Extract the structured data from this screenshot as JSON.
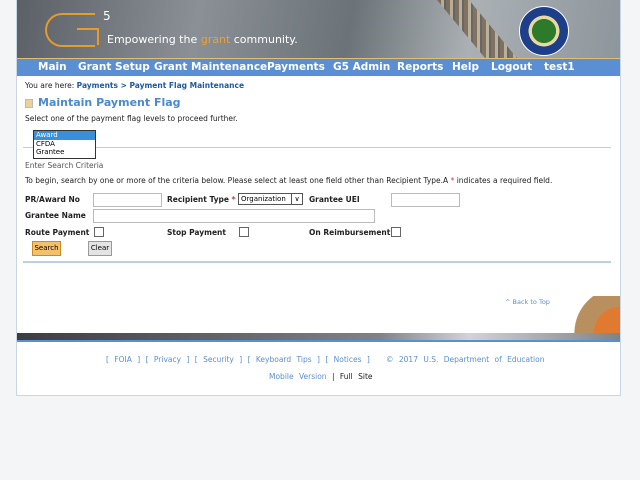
{
  "header": {
    "logo_sup": "5",
    "tagline_pre": "Empowering the ",
    "tagline_accent": "grant",
    "tagline_post": " community."
  },
  "nav": [
    "Main",
    "Grant Setup",
    "Grant Maintenance",
    "Payments",
    "G5 Admin",
    "Reports",
    "Help",
    "Logout",
    "test1"
  ],
  "breadcrumb": {
    "prefix": "You are here:",
    "path": "Payments > Payment Flag Maintenance"
  },
  "page_title": "Maintain Payment Flag",
  "intro": "Select one of the payment flag levels to proceed further.",
  "flag_levels": {
    "options": [
      "Award",
      "CFDA",
      "Grantee"
    ],
    "selected": "Award"
  },
  "section_label": "Enter Search Criteria",
  "instructions": "To begin, search by one or more of the criteria below. Please select at least one field other than Recipient Type.A",
  "instructions_end": "indicates a required field.",
  "required_mark": "*",
  "form": {
    "pr_award_label": "PR/Award No",
    "pr_award_value": "",
    "recipient_type_label": "Recipient Type",
    "recipient_type_value": "Organization",
    "grantee_uei_label": "Grantee UEI",
    "grantee_uei_value": "",
    "grantee_name_label": "Grantee Name",
    "grantee_name_value": "",
    "route_payment_label": "Route Payment",
    "stop_payment_label": "Stop Payment",
    "on_reimbursement_label": "On Reimbursement",
    "search_label": "Search",
    "clear_label": "Clear"
  },
  "back_to_top": "^ Back to Top",
  "footer": {
    "links": [
      "FOIA",
      "Privacy",
      "Security",
      "Keyboard Tips",
      "Notices"
    ],
    "copyright": "© 2017 U.S. Department of Education",
    "mobile": "Mobile Version",
    "separator": "|",
    "full_site": "Full Site"
  },
  "colors": {
    "nav": "#5b8fd3",
    "accent": "#4a8ad0",
    "search_button": "#f5c06a"
  }
}
